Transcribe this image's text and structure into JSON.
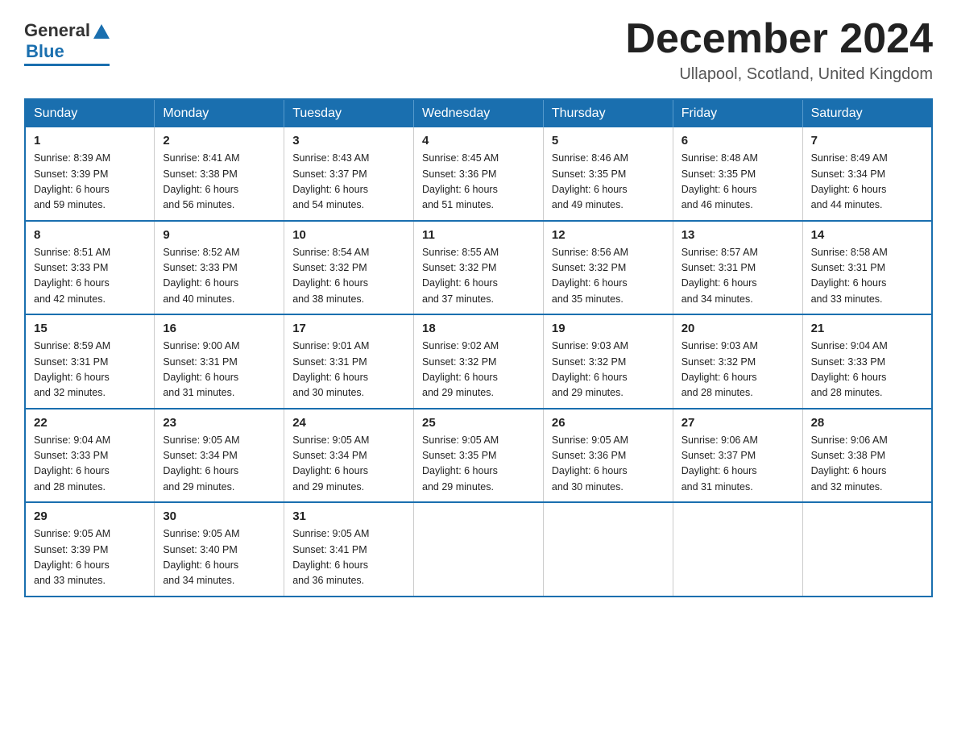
{
  "header": {
    "logo_general": "General",
    "logo_blue": "Blue",
    "month_title": "December 2024",
    "location": "Ullapool, Scotland, United Kingdom"
  },
  "weekdays": [
    "Sunday",
    "Monday",
    "Tuesday",
    "Wednesday",
    "Thursday",
    "Friday",
    "Saturday"
  ],
  "weeks": [
    [
      {
        "day": "1",
        "sunrise": "8:39 AM",
        "sunset": "3:39 PM",
        "daylight": "6 hours and 59 minutes."
      },
      {
        "day": "2",
        "sunrise": "8:41 AM",
        "sunset": "3:38 PM",
        "daylight": "6 hours and 56 minutes."
      },
      {
        "day": "3",
        "sunrise": "8:43 AM",
        "sunset": "3:37 PM",
        "daylight": "6 hours and 54 minutes."
      },
      {
        "day": "4",
        "sunrise": "8:45 AM",
        "sunset": "3:36 PM",
        "daylight": "6 hours and 51 minutes."
      },
      {
        "day": "5",
        "sunrise": "8:46 AM",
        "sunset": "3:35 PM",
        "daylight": "6 hours and 49 minutes."
      },
      {
        "day": "6",
        "sunrise": "8:48 AM",
        "sunset": "3:35 PM",
        "daylight": "6 hours and 46 minutes."
      },
      {
        "day": "7",
        "sunrise": "8:49 AM",
        "sunset": "3:34 PM",
        "daylight": "6 hours and 44 minutes."
      }
    ],
    [
      {
        "day": "8",
        "sunrise": "8:51 AM",
        "sunset": "3:33 PM",
        "daylight": "6 hours and 42 minutes."
      },
      {
        "day": "9",
        "sunrise": "8:52 AM",
        "sunset": "3:33 PM",
        "daylight": "6 hours and 40 minutes."
      },
      {
        "day": "10",
        "sunrise": "8:54 AM",
        "sunset": "3:32 PM",
        "daylight": "6 hours and 38 minutes."
      },
      {
        "day": "11",
        "sunrise": "8:55 AM",
        "sunset": "3:32 PM",
        "daylight": "6 hours and 37 minutes."
      },
      {
        "day": "12",
        "sunrise": "8:56 AM",
        "sunset": "3:32 PM",
        "daylight": "6 hours and 35 minutes."
      },
      {
        "day": "13",
        "sunrise": "8:57 AM",
        "sunset": "3:31 PM",
        "daylight": "6 hours and 34 minutes."
      },
      {
        "day": "14",
        "sunrise": "8:58 AM",
        "sunset": "3:31 PM",
        "daylight": "6 hours and 33 minutes."
      }
    ],
    [
      {
        "day": "15",
        "sunrise": "8:59 AM",
        "sunset": "3:31 PM",
        "daylight": "6 hours and 32 minutes."
      },
      {
        "day": "16",
        "sunrise": "9:00 AM",
        "sunset": "3:31 PM",
        "daylight": "6 hours and 31 minutes."
      },
      {
        "day": "17",
        "sunrise": "9:01 AM",
        "sunset": "3:31 PM",
        "daylight": "6 hours and 30 minutes."
      },
      {
        "day": "18",
        "sunrise": "9:02 AM",
        "sunset": "3:32 PM",
        "daylight": "6 hours and 29 minutes."
      },
      {
        "day": "19",
        "sunrise": "9:03 AM",
        "sunset": "3:32 PM",
        "daylight": "6 hours and 29 minutes."
      },
      {
        "day": "20",
        "sunrise": "9:03 AM",
        "sunset": "3:32 PM",
        "daylight": "6 hours and 28 minutes."
      },
      {
        "day": "21",
        "sunrise": "9:04 AM",
        "sunset": "3:33 PM",
        "daylight": "6 hours and 28 minutes."
      }
    ],
    [
      {
        "day": "22",
        "sunrise": "9:04 AM",
        "sunset": "3:33 PM",
        "daylight": "6 hours and 28 minutes."
      },
      {
        "day": "23",
        "sunrise": "9:05 AM",
        "sunset": "3:34 PM",
        "daylight": "6 hours and 29 minutes."
      },
      {
        "day": "24",
        "sunrise": "9:05 AM",
        "sunset": "3:34 PM",
        "daylight": "6 hours and 29 minutes."
      },
      {
        "day": "25",
        "sunrise": "9:05 AM",
        "sunset": "3:35 PM",
        "daylight": "6 hours and 29 minutes."
      },
      {
        "day": "26",
        "sunrise": "9:05 AM",
        "sunset": "3:36 PM",
        "daylight": "6 hours and 30 minutes."
      },
      {
        "day": "27",
        "sunrise": "9:06 AM",
        "sunset": "3:37 PM",
        "daylight": "6 hours and 31 minutes."
      },
      {
        "day": "28",
        "sunrise": "9:06 AM",
        "sunset": "3:38 PM",
        "daylight": "6 hours and 32 minutes."
      }
    ],
    [
      {
        "day": "29",
        "sunrise": "9:05 AM",
        "sunset": "3:39 PM",
        "daylight": "6 hours and 33 minutes."
      },
      {
        "day": "30",
        "sunrise": "9:05 AM",
        "sunset": "3:40 PM",
        "daylight": "6 hours and 34 minutes."
      },
      {
        "day": "31",
        "sunrise": "9:05 AM",
        "sunset": "3:41 PM",
        "daylight": "6 hours and 36 minutes."
      },
      null,
      null,
      null,
      null
    ]
  ],
  "labels": {
    "sunrise": "Sunrise:",
    "sunset": "Sunset:",
    "daylight": "Daylight:"
  }
}
